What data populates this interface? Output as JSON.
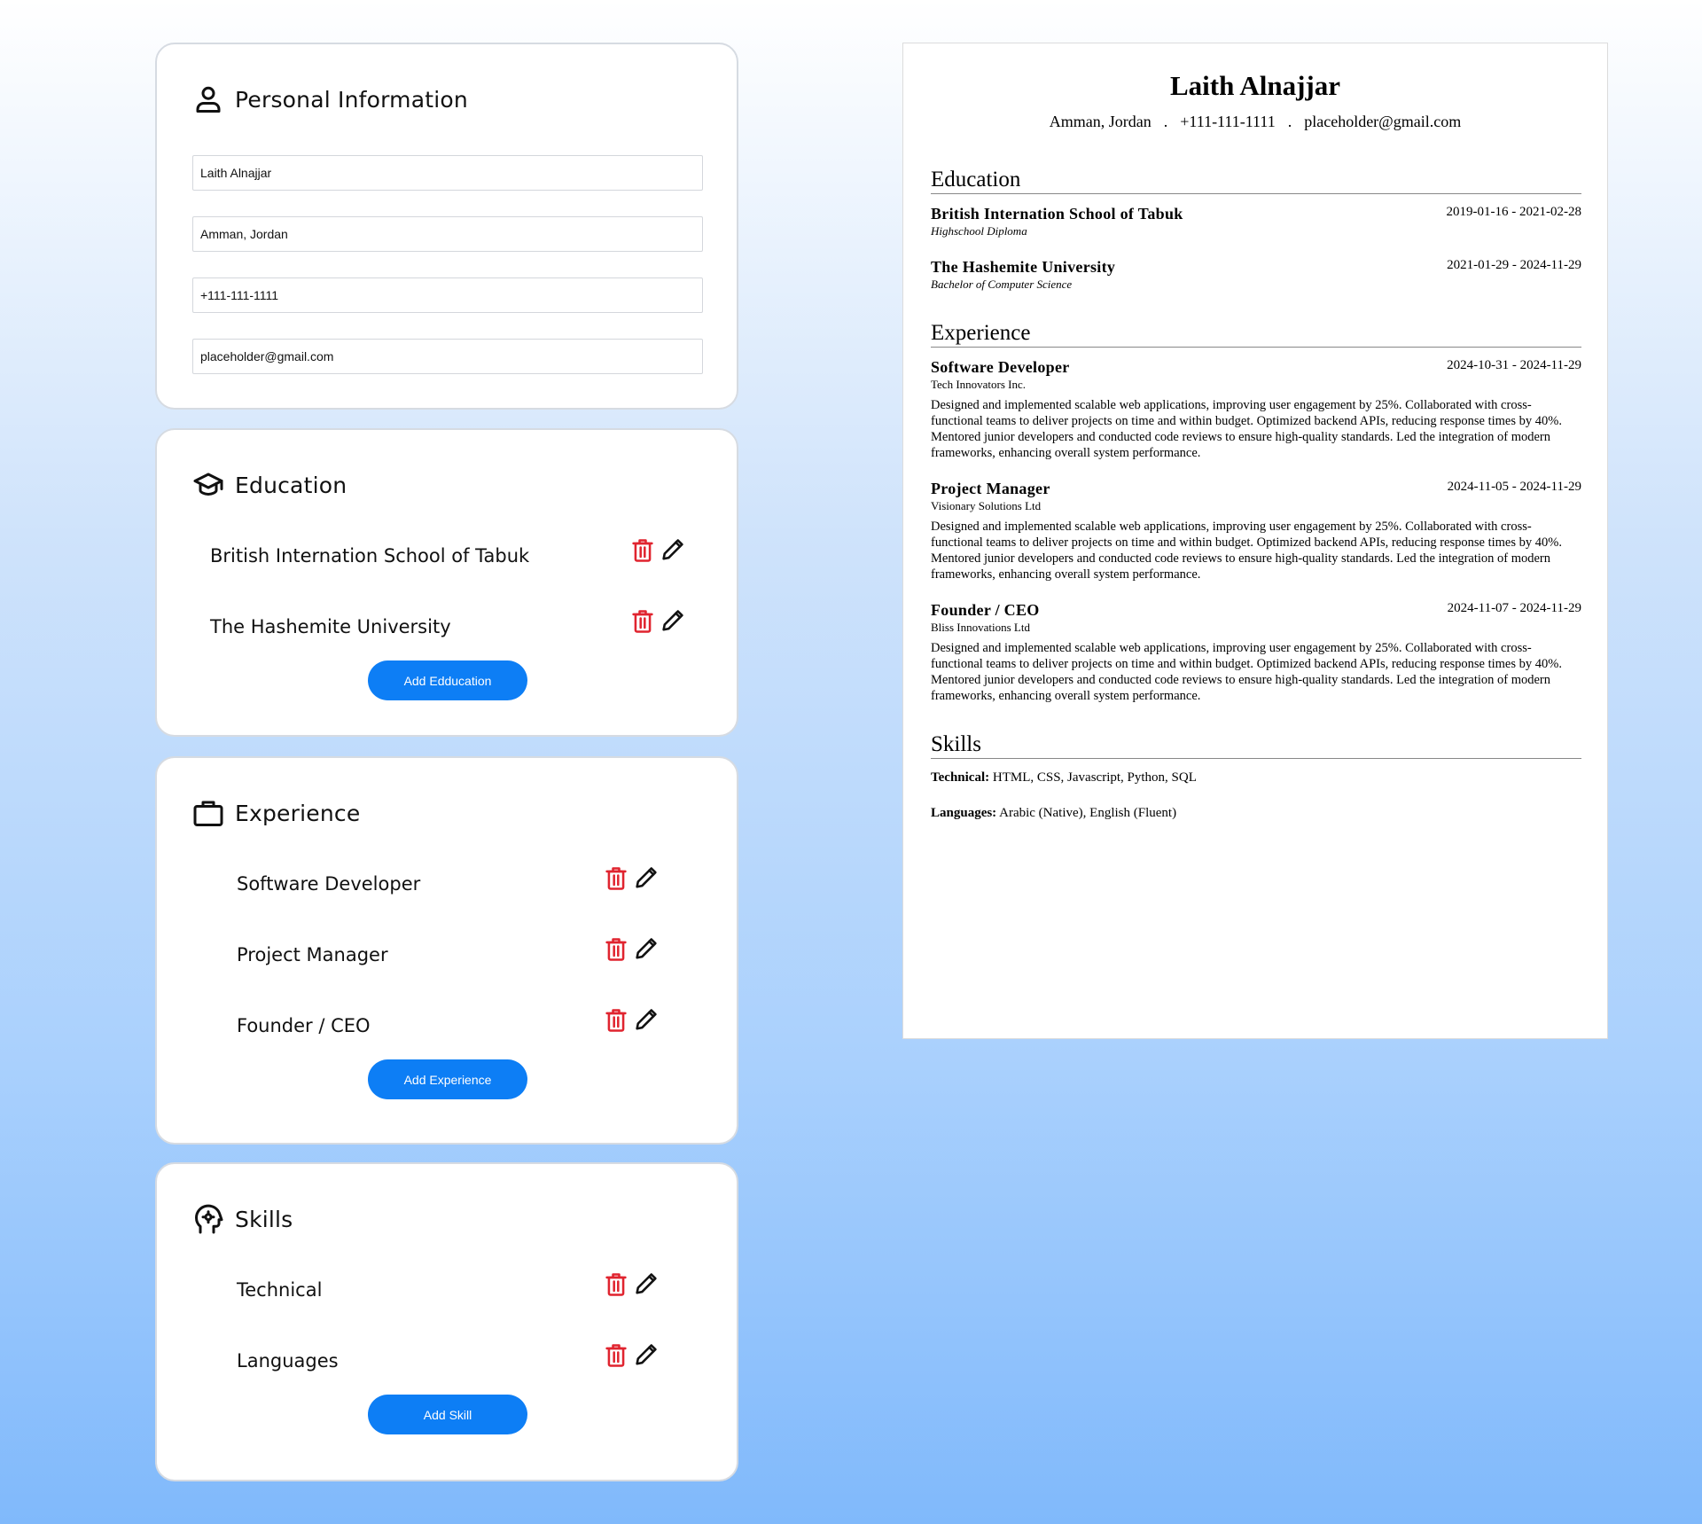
{
  "personal": {
    "title": "Personal Information",
    "name": "Laith Alnajjar",
    "location": "Amman, Jordan",
    "phone": "+111-111-1111",
    "email": "placeholder@gmail.com"
  },
  "education": {
    "title": "Education",
    "items": [
      {
        "label": "British Internation School of Tabuk"
      },
      {
        "label": "The Hashemite University"
      }
    ],
    "add_label": "Add Edducation"
  },
  "experience": {
    "title": "Experience",
    "items": [
      {
        "label": "Software Developer"
      },
      {
        "label": "Project Manager"
      },
      {
        "label": "Founder / CEO"
      }
    ],
    "add_label": "Add Experience"
  },
  "skills": {
    "title": "Skills",
    "items": [
      {
        "label": "Technical"
      },
      {
        "label": "Languages"
      }
    ],
    "add_label": "Add Skill"
  },
  "icons": {
    "delete_color": "#e0242f",
    "edit_color": "#111111",
    "accent": "#0d7ef5"
  },
  "resume": {
    "name": "Laith Alnajjar",
    "location": "Amman, Jordan",
    "phone": "+111-111-1111",
    "email": "placeholder@gmail.com",
    "separator": ".",
    "education_heading": "Education",
    "education": [
      {
        "school": "British Internation School of Tabuk",
        "degree": "Highschool Diploma",
        "dates": "2019-01-16 - 2021-02-28"
      },
      {
        "school": "The Hashemite University",
        "degree": "Bachelor of Computer Science",
        "dates": "2021-01-29 - 2024-11-29"
      }
    ],
    "experience_heading": "Experience",
    "experience": [
      {
        "role": "Software Developer",
        "company": "Tech Innovators Inc.",
        "dates": "2024-10-31 - 2024-11-29",
        "description": "Designed and implemented scalable web applications, improving user engagement by 25%. Collaborated with cross-functional teams to deliver projects on time and within budget. Optimized backend APIs, reducing response times by 40%. Mentored junior developers and conducted code reviews to ensure high-quality standards. Led the integration of modern frameworks, enhancing overall system performance."
      },
      {
        "role": "Project Manager",
        "company": "Visionary Solutions Ltd",
        "dates": "2024-11-05 - 2024-11-29",
        "description": "Designed and implemented scalable web applications, improving user engagement by 25%. Collaborated with cross-functional teams to deliver projects on time and within budget. Optimized backend APIs, reducing response times by 40%. Mentored junior developers and conducted code reviews to ensure high-quality standards. Led the integration of modern frameworks, enhancing overall system performance."
      },
      {
        "role": "Founder / CEO",
        "company": "Bliss Innovations Ltd",
        "dates": "2024-11-07 - 2024-11-29",
        "description": "Designed and implemented scalable web applications, improving user engagement by 25%. Collaborated with cross-functional teams to deliver projects on time and within budget. Optimized backend APIs, reducing response times by 40%. Mentored junior developers and conducted code reviews to ensure high-quality standards. Led the integration of modern frameworks, enhancing overall system performance."
      }
    ],
    "skills_heading": "Skills",
    "skills": [
      {
        "category": "Technical:",
        "value": "HTML, CSS, Javascript, Python, SQL"
      },
      {
        "category": "Languages:",
        "value": "Arabic (Native), English (Fluent)"
      }
    ]
  }
}
